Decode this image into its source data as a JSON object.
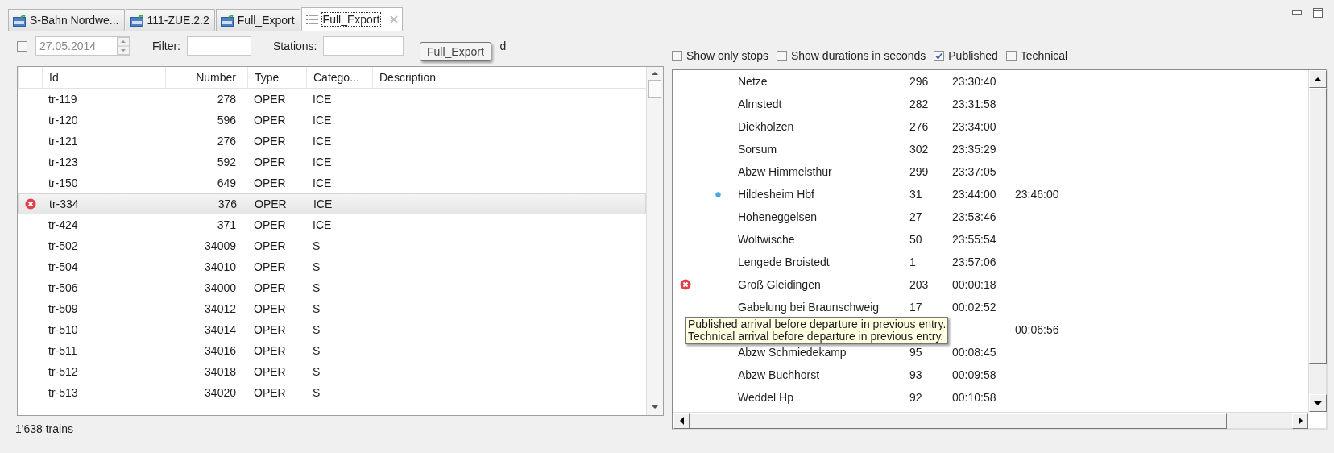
{
  "tabs": [
    {
      "label": "S-Bahn Nordwe...",
      "selected": false
    },
    {
      "label": "111-ZUE.2.2",
      "selected": false
    },
    {
      "label": "Full_Export",
      "selected": false
    },
    {
      "label": "Full_Export",
      "selected": true
    }
  ],
  "tab_tooltip": "Full_Export",
  "toolbar": {
    "date_checked": false,
    "date": "27.05.2014",
    "filter_label": "Filter:",
    "stations_label": "Stations:",
    "stations_suffix": "d"
  },
  "options": [
    {
      "label": "Show only stops",
      "checked": false
    },
    {
      "label": "Show durations in seconds",
      "checked": false
    },
    {
      "label": "Published",
      "checked": true
    },
    {
      "label": "Technical",
      "checked": false
    }
  ],
  "trains": {
    "columns": [
      "Id",
      "Number",
      "Type",
      "Catego...",
      "Description"
    ],
    "rows": [
      {
        "id": "tr-119",
        "number": "278",
        "type": "OPER",
        "category": "ICE",
        "selected": false
      },
      {
        "id": "tr-120",
        "number": "596",
        "type": "OPER",
        "category": "ICE",
        "selected": false
      },
      {
        "id": "tr-121",
        "number": "276",
        "type": "OPER",
        "category": "ICE",
        "selected": false
      },
      {
        "id": "tr-123",
        "number": "592",
        "type": "OPER",
        "category": "ICE",
        "selected": false
      },
      {
        "id": "tr-150",
        "number": "649",
        "type": "OPER",
        "category": "ICE",
        "selected": false
      },
      {
        "id": "tr-334",
        "number": "376",
        "type": "OPER",
        "category": "ICE",
        "selected": true,
        "kind": "error"
      },
      {
        "id": "tr-424",
        "number": "371",
        "type": "OPER",
        "category": "ICE",
        "selected": false
      },
      {
        "id": "tr-502",
        "number": "34009",
        "type": "OPER",
        "category": "S",
        "selected": false
      },
      {
        "id": "tr-504",
        "number": "34010",
        "type": "OPER",
        "category": "S",
        "selected": false
      },
      {
        "id": "tr-506",
        "number": "34000",
        "type": "OPER",
        "category": "S",
        "selected": false
      },
      {
        "id": "tr-509",
        "number": "34012",
        "type": "OPER",
        "category": "S",
        "selected": false
      },
      {
        "id": "tr-510",
        "number": "34014",
        "type": "OPER",
        "category": "S",
        "selected": false
      },
      {
        "id": "tr-511",
        "number": "34016",
        "type": "OPER",
        "category": "S",
        "selected": false
      },
      {
        "id": "tr-512",
        "number": "34018",
        "type": "OPER",
        "category": "S",
        "selected": false
      },
      {
        "id": "tr-513",
        "number": "34020",
        "type": "OPER",
        "category": "S",
        "selected": false
      }
    ]
  },
  "stops": [
    {
      "name": "Netze",
      "number": "296",
      "arrival": "23:30:40"
    },
    {
      "name": "Almstedt",
      "number": "282",
      "arrival": "23:31:58"
    },
    {
      "name": "Diekholzen",
      "number": "276",
      "arrival": "23:34:00"
    },
    {
      "name": "Sorsum",
      "number": "302",
      "arrival": "23:35:29"
    },
    {
      "name": "Abzw Himmelsthür",
      "number": "299",
      "arrival": "23:37:05"
    },
    {
      "name": "Hildesheim Hbf",
      "number": "31",
      "arrival": "23:44:00",
      "departure": "23:46:00",
      "kind": "info"
    },
    {
      "name": "Hoheneggelsen",
      "number": "27",
      "arrival": "23:53:46"
    },
    {
      "name": "Woltwische",
      "number": "50",
      "arrival": "23:55:54"
    },
    {
      "name": "Lengede Broistedt",
      "number": "1",
      "arrival": "23:57:06"
    },
    {
      "name": "Groß Gleidingen",
      "number": "203",
      "arrival": "00:00:18",
      "kind": "error"
    },
    {
      "name": "Gabelung bei Braunschweig",
      "number": "17",
      "arrival": "00:02:52"
    },
    {
      "departure": "00:06:56"
    },
    {
      "name": "Abzw Schmiedekamp",
      "number": "95",
      "arrival": "00:08:45"
    },
    {
      "name": "Abzw Buchhorst",
      "number": "93",
      "arrival": "00:09:58"
    },
    {
      "name": "Weddel Hp",
      "number": "92",
      "arrival": "00:10:58"
    }
  ],
  "stops_tooltip": [
    "Published arrival before departure in previous entry.",
    "Technical arrival before departure in previous entry."
  ],
  "status": "1'638 trains"
}
